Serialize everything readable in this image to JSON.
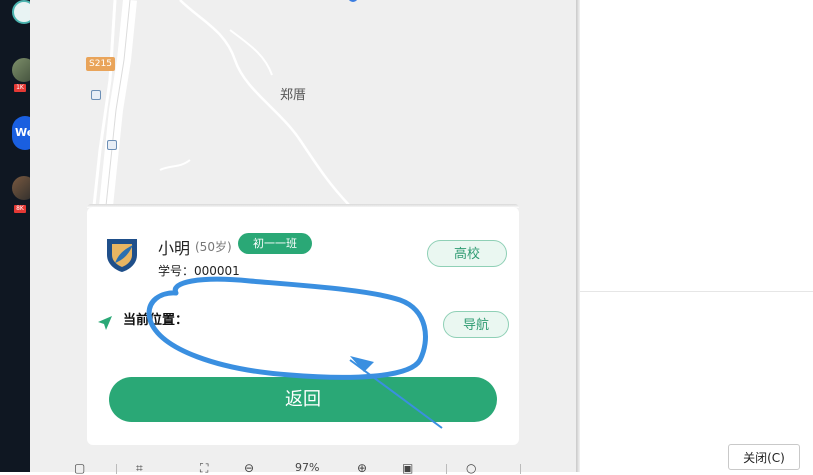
{
  "taskbar": {
    "items": [
      {
        "name": "app-1",
        "badge": ""
      },
      {
        "name": "app-2",
        "badge": "1K"
      },
      {
        "name": "app-3",
        "text": "We"
      },
      {
        "name": "app-4",
        "badge": "8K"
      }
    ]
  },
  "map": {
    "road_tag": "S215",
    "place_label": "郑厝"
  },
  "student": {
    "name": "小明",
    "age": "(50岁)",
    "class_badge": "初一一班",
    "id_label": "学号：000001",
    "school_button": "高校"
  },
  "location": {
    "label": "当前位置：",
    "nav_button": "导航"
  },
  "actions": {
    "back_button": "返回"
  },
  "toolbar": {
    "zoom": "97%"
  },
  "dialog": {
    "close_button": "关闭(C)"
  },
  "colors": {
    "accent": "#2aa876",
    "accent_light": "#eaf7f1",
    "annotation": "#3a8fe0"
  }
}
